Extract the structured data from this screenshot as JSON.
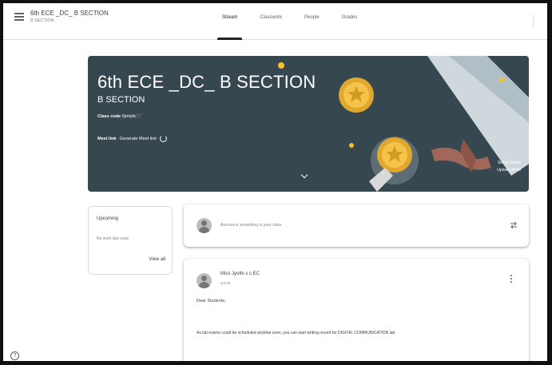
{
  "header": {
    "class_title": "6th ECE _DC_ B SECTION",
    "class_subtitle": "B SECTION",
    "tabs": [
      {
        "label": "Stream",
        "active": true
      },
      {
        "label": "Classwork",
        "active": false
      },
      {
        "label": "People",
        "active": false
      },
      {
        "label": "Grades",
        "active": false
      }
    ]
  },
  "banner": {
    "title": "6th ECE _DC_ B SECTION",
    "section": "B SECTION",
    "class_code_label": "Class code",
    "class_code": "5jmtyfs",
    "meet_label": "Meet link",
    "meet_value": "Generate Meet link",
    "info_line1": "Select theme",
    "info_line2": "Upload photo",
    "background_color": "#37474f"
  },
  "upcoming": {
    "title": "Upcoming",
    "empty_text": "No work due soon",
    "link": "View all"
  },
  "announce": {
    "placeholder": "Announce something to your class"
  },
  "post": {
    "author": "Miss Jyothi s s EC",
    "date": "Jul 28",
    "greeting": "Dear Students,",
    "body": "As lab exams could be scheduled anytime soon, you can start writing record for  DIGITAL COMMUNICATION lab."
  },
  "icons": [
    "menu-icon",
    "copy-icon",
    "refresh-icon",
    "chevron-down-icon",
    "repost-icon",
    "kebab-icon",
    "help-icon"
  ]
}
